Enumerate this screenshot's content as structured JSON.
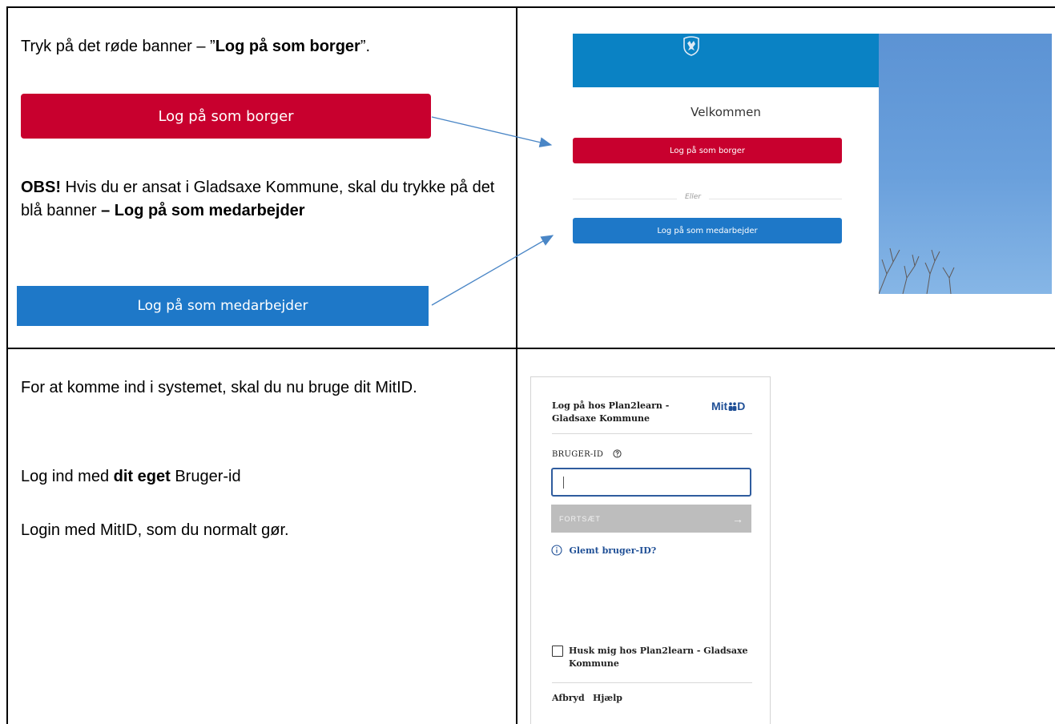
{
  "row1": {
    "intro_prefix": "Tryk på det røde banner – ”",
    "intro_bold": "Log på som borger",
    "intro_suffix": "”.",
    "red_button": "Log på som borger",
    "obs_bold": "OBS!",
    "obs_text": " Hvis du er ansat i Gladsaxe Kommune, skal du trykke på det blå banner ",
    "obs_bold2": "– Log på som medarbejder",
    "blue_button": "Log på som medarbejder"
  },
  "login_page": {
    "welcome": "Velkommen",
    "citizen_button": "Log på som borger",
    "or_text": "Eller",
    "employee_button": "Log på som medarbejder"
  },
  "row2": {
    "p1": "For at komme ind i systemet, skal du nu bruge dit MitID.",
    "p2_prefix": "Log ind med ",
    "p2_bold": "dit eget",
    "p2_suffix": " Bruger-id",
    "p3": "Login med MitID, som du normalt gør."
  },
  "mitid": {
    "title_line1": "Log på hos Plan2learn -",
    "title_line2": "Gladsaxe Kommune",
    "logo_text": "Mit",
    "logo_suffix": "D",
    "user_id_label": "BRUGER-ID",
    "continue_label": "FORTSÆT",
    "forgot_link": "Glemt bruger-ID?",
    "remember_line1": "Husk mig hos Plan2learn - Gladsaxe",
    "remember_line2": "Kommune",
    "cancel": "Afbryd",
    "help": "Hjælp"
  },
  "colors": {
    "red_banner": "#c8002e",
    "blue_banner": "#1e78c8",
    "header_blue": "#0a82c4",
    "arrow": "#4a86c6",
    "mitid_blue": "#1f4f96"
  }
}
